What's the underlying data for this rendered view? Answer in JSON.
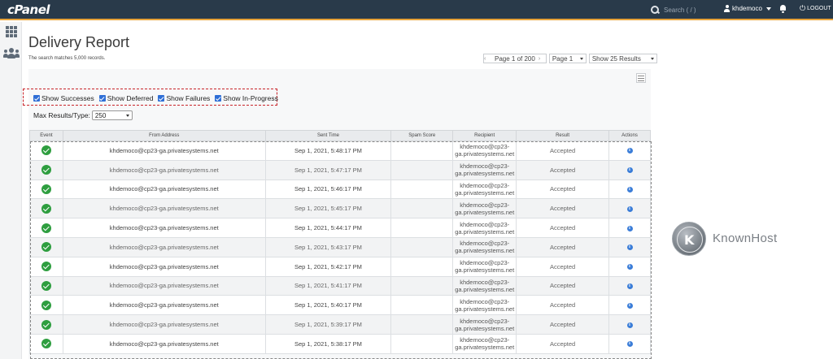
{
  "topbar": {
    "logo": "cPanel",
    "search_placeholder": "Search ( / )",
    "username": "khdemoco",
    "logout": "LOGOUT"
  },
  "page": {
    "title": "Delivery Report",
    "records_note": "The search matches 5,000 records."
  },
  "pager": {
    "page_of": "Page 1 of 200",
    "page_select": "Page 1",
    "results_select": "Show 25 Results"
  },
  "filters": {
    "items": [
      "Show Successes",
      "Show Deferred",
      "Show Failures",
      "Show In-Progress"
    ],
    "max_label": "Max Results/Type:",
    "max_value": "250"
  },
  "table": {
    "headers": [
      "Event",
      "From Address",
      "Sent Time",
      "Spam Score",
      "Recipient",
      "Result",
      "Actions"
    ],
    "rows": [
      {
        "from": "khdemoco@cp23-ga.privatesystems.net",
        "sent": "Sep 1, 2021, 5:48:17 PM",
        "spam": "",
        "recipient_1": "khdemoco@cp23-",
        "recipient_2": "ga.privatesystems.net",
        "result": "Accepted"
      },
      {
        "from": "khdemoco@cp23-ga.privatesystems.net",
        "sent": "Sep 1, 2021, 5:47:17 PM",
        "spam": "",
        "recipient_1": "khdemoco@cp23-",
        "recipient_2": "ga.privatesystems.net",
        "result": "Accepted"
      },
      {
        "from": "khdemoco@cp23-ga.privatesystems.net",
        "sent": "Sep 1, 2021, 5:46:17 PM",
        "spam": "",
        "recipient_1": "khdemoco@cp23-",
        "recipient_2": "ga.privatesystems.net",
        "result": "Accepted"
      },
      {
        "from": "khdemoco@cp23-ga.privatesystems.net",
        "sent": "Sep 1, 2021, 5:45:17 PM",
        "spam": "",
        "recipient_1": "khdemoco@cp23-",
        "recipient_2": "ga.privatesystems.net",
        "result": "Accepted"
      },
      {
        "from": "khdemoco@cp23-ga.privatesystems.net",
        "sent": "Sep 1, 2021, 5:44:17 PM",
        "spam": "",
        "recipient_1": "khdemoco@cp23-",
        "recipient_2": "ga.privatesystems.net",
        "result": "Accepted"
      },
      {
        "from": "khdemoco@cp23-ga.privatesystems.net",
        "sent": "Sep 1, 2021, 5:43:17 PM",
        "spam": "",
        "recipient_1": "khdemoco@cp23-",
        "recipient_2": "ga.privatesystems.net",
        "result": "Accepted"
      },
      {
        "from": "khdemoco@cp23-ga.privatesystems.net",
        "sent": "Sep 1, 2021, 5:42:17 PM",
        "spam": "",
        "recipient_1": "khdemoco@cp23-",
        "recipient_2": "ga.privatesystems.net",
        "result": "Accepted"
      },
      {
        "from": "khdemoco@cp23-ga.privatesystems.net",
        "sent": "Sep 1, 2021, 5:41:17 PM",
        "spam": "",
        "recipient_1": "khdemoco@cp23-",
        "recipient_2": "ga.privatesystems.net",
        "result": "Accepted"
      },
      {
        "from": "khdemoco@cp23-ga.privatesystems.net",
        "sent": "Sep 1, 2021, 5:40:17 PM",
        "spam": "",
        "recipient_1": "khdemoco@cp23-",
        "recipient_2": "ga.privatesystems.net",
        "result": "Accepted"
      },
      {
        "from": "khdemoco@cp23-ga.privatesystems.net",
        "sent": "Sep 1, 2021, 5:39:17 PM",
        "spam": "",
        "recipient_1": "khdemoco@cp23-",
        "recipient_2": "ga.privatesystems.net",
        "result": "Accepted"
      },
      {
        "from": "khdemoco@cp23-ga.privatesystems.net",
        "sent": "Sep 1, 2021, 5:38:17 PM",
        "spam": "",
        "recipient_1": "khdemoco@cp23-",
        "recipient_2": "ga.privatesystems.net",
        "result": "Accepted"
      }
    ]
  },
  "watermark": {
    "brand": "KnownHost",
    "mark": "K"
  },
  "colors": {
    "topbar": "#293a4a",
    "accent": "#e8a33a",
    "success": "#2e9e3f",
    "info": "#3b7dd8",
    "highlight_box": "#c8242a"
  },
  "icons": {
    "event": "success-check-icon",
    "action": "info-icon"
  }
}
